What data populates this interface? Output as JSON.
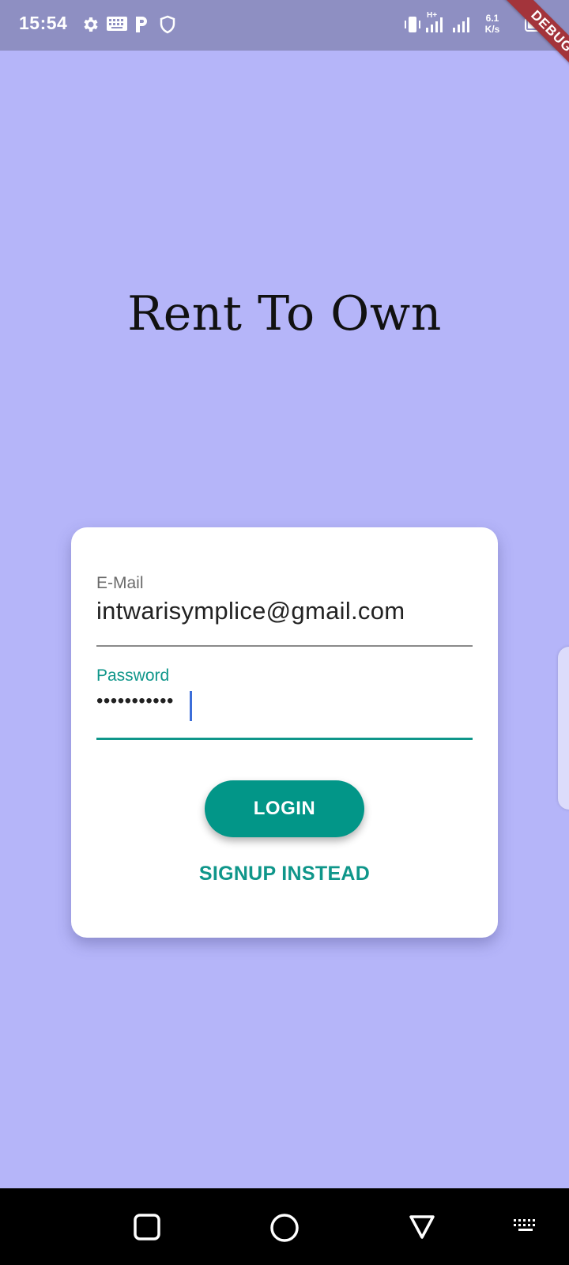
{
  "status_bar": {
    "time": "15:54",
    "network_type": "H+",
    "speed_value": "6.1",
    "speed_unit": "K/s",
    "icons": [
      "gear-icon",
      "keyboard-icon",
      "p-icon",
      "shield-icon",
      "vibrate-icon",
      "signal-icon",
      "signal-icon",
      "battery-icon"
    ]
  },
  "debug_banner": "DEBUG",
  "app": {
    "title": "Rent To Own"
  },
  "login_form": {
    "email_label": "E-Mail",
    "email_value": "intwarisymplice@gmail.com",
    "password_label": "Password",
    "password_value": "•••••••••••",
    "login_label": "LOGIN",
    "signup_label": "SIGNUP INSTEAD"
  },
  "nav_bar": {
    "icons": [
      "recents-icon",
      "home-icon",
      "back-icon",
      "keyboard-icon"
    ]
  },
  "colors": {
    "background": "#b5b5f9",
    "status_bar": "#8e8fc2",
    "accent": "#029688",
    "card": "#ffffff",
    "debug_ribbon": "#a3343b"
  }
}
